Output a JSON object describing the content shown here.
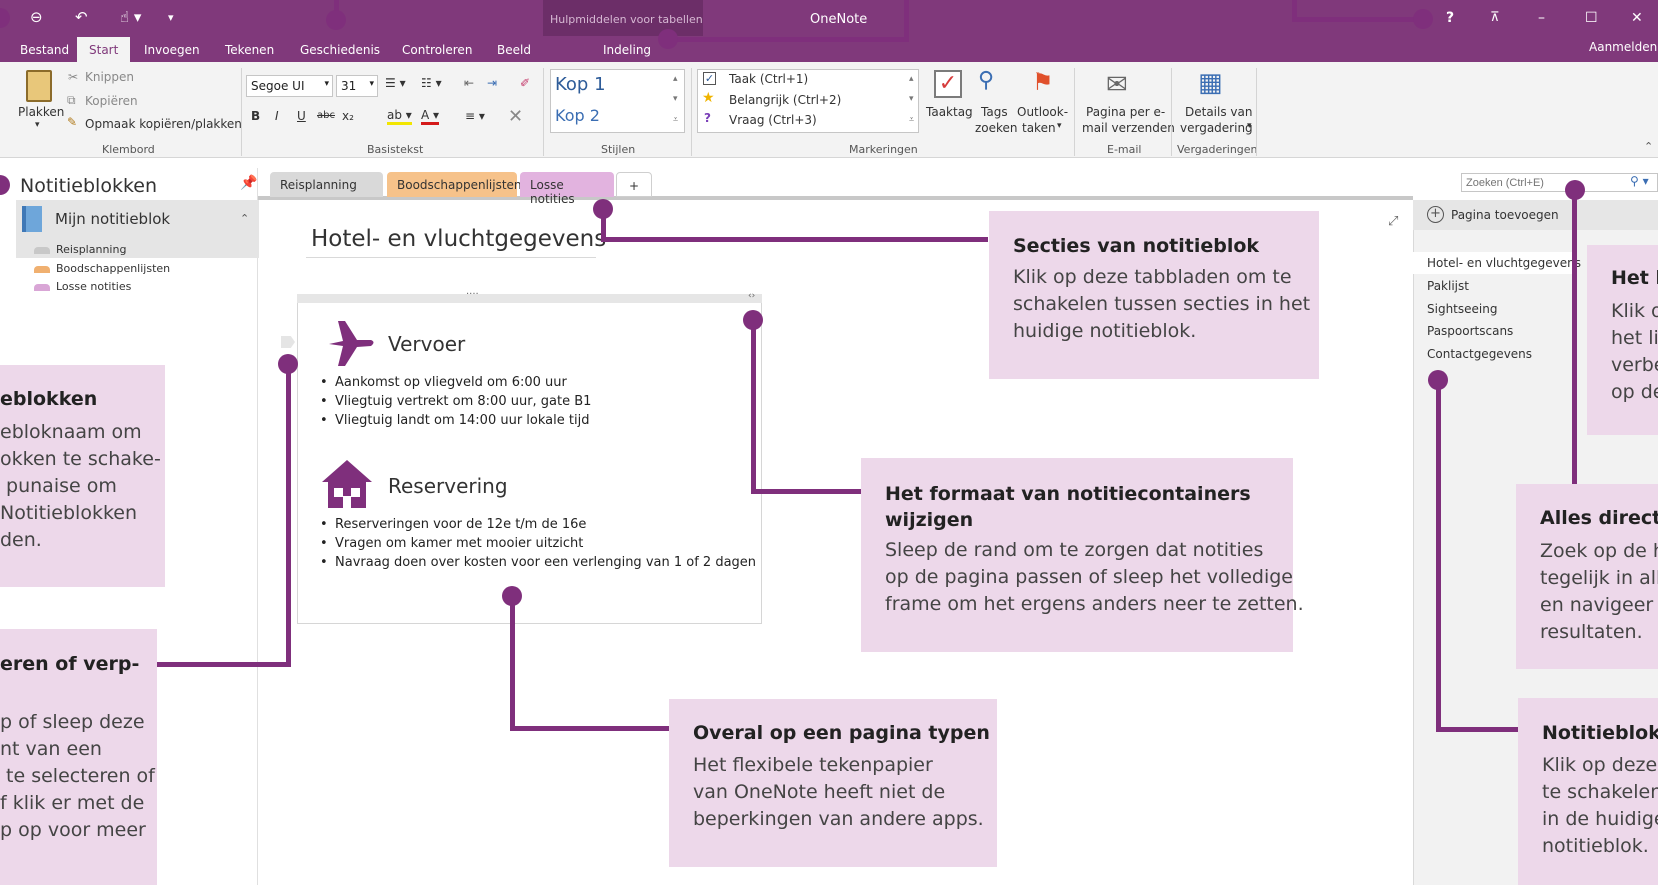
{
  "titlebar": {
    "app_title": "OneNote",
    "context_label": "Hulpmiddelen voor tabellen",
    "signin": "Aanmelden",
    "help": "?",
    "icons": [
      "back-icon",
      "undo-icon",
      "touch-mode-icon",
      "customize-qat-icon",
      "ribbon-display-icon",
      "minimize-icon",
      "maximize-icon",
      "close-icon"
    ]
  },
  "ribbon_tabs": [
    "Bestand",
    "Start",
    "Invoegen",
    "Tekenen",
    "Geschiedenis",
    "Controleren",
    "Beeld",
    "Indeling"
  ],
  "ribbon": {
    "clipboard": {
      "paste": "Plakken",
      "cut": "Knippen",
      "copy": "Kopiëren",
      "format_painter": "Opmaak kopiëren/plakken",
      "label": "Klembord"
    },
    "basic_text": {
      "font": "Segoe UI",
      "size": "31",
      "label": "Basistekst",
      "buttons": [
        "B",
        "I",
        "U",
        "abc",
        "x₂"
      ]
    },
    "styles": {
      "items": [
        "Kop 1",
        "Kop 2"
      ],
      "label": "Stijlen"
    },
    "tags": {
      "items": [
        "Taak (Ctrl+1)",
        "Belangrijk (Ctrl+2)",
        "Vraag (Ctrl+3)"
      ],
      "todo": "Taaktag",
      "find": [
        "Tags",
        "zoeken"
      ],
      "outlook": [
        "Outlook-",
        "taken"
      ],
      "label": "Markeringen"
    },
    "email": {
      "button": [
        "Pagina per e-",
        "mail verzenden"
      ],
      "label": "E-mail"
    },
    "meetings": {
      "button": [
        "Details van",
        "vergadering"
      ],
      "label": "Vergaderingen"
    }
  },
  "notebooks": {
    "header": "Notitieblokken",
    "notebook_name": "Mijn notitieblok",
    "sections": [
      {
        "name": "Reisplanning",
        "color": "#c8c8c8"
      },
      {
        "name": "Boodschappenlijsten",
        "color": "#f0b070"
      },
      {
        "name": "Losse notities",
        "color": "#d9a6d6"
      }
    ]
  },
  "section_tabs": [
    {
      "label": "Reisplanning",
      "color": "#d9d9d9"
    },
    {
      "label": "Boodschappenlijsten",
      "color": "#f6c28a"
    },
    {
      "label": "Losse notities",
      "color": "#e2b3df"
    },
    {
      "label": "+",
      "color": "#ffffff"
    }
  ],
  "search": {
    "placeholder": "Zoeken (Ctrl+E)"
  },
  "page": {
    "title": "Hotel- en vluchtgegevens",
    "blocks": [
      {
        "heading": "Vervoer",
        "icon": "airplane-icon",
        "bullets": [
          "Aankomst op vliegveld om 6:00 uur",
          "Vliegtuig vertrekt om 8:00 uur, gate B1",
          "Vliegtuig landt om 14:00 uur lokale tijd"
        ]
      },
      {
        "heading": "Reservering",
        "icon": "house-icon",
        "bullets": [
          "Reserveringen voor de 12e t/m de 16e",
          "Vragen om kamer met mooier uitzicht",
          "Navraag doen over kosten voor een verlenging van 1 of 2 dagen"
        ]
      }
    ]
  },
  "pages_pane": {
    "add_page": "Pagina toevoegen",
    "pages": [
      "Hotel- en vluchtgegevens",
      "Paklijst",
      "Sightseeing",
      "Paspoortscans",
      "Contactgegevens"
    ]
  },
  "callouts": {
    "sections": {
      "title": "Secties van notitieblok",
      "body": "Klik op deze tabbladen om te\nschakelen tussen secties in het\nhuidige notitieblok."
    },
    "resize": {
      "title": "Het formaat van notitiecontainers\nwijzigen",
      "body": "Sleep de rand om te zorgen dat notities\nop de pagina passen of sleep het volledige\nframe om het ergens anders neer te zetten."
    },
    "type_anywhere": {
      "title": "Overal op een pagina typen",
      "body": "Het flexibele tekenpapier\nvan OneNote heeft niet de\nbeperkingen van andere apps."
    },
    "notebooks": {
      "title": "eblokken",
      "body": "ebloknaam om\nokken te schake-\n punaise om\nNotitieblokken\nden."
    },
    "select_move": {
      "title": "eren of verp-",
      "body": "p of sleep deze\nnt van een\n te selecteren of\nf klik er met de\np op voor meer"
    },
    "link": {
      "title": "Het l",
      "body": "Klik o\nhet lin\nverbe\nop de"
    },
    "search_all": {
      "title": "Alles direct v",
      "body": "Zoek op de h\ntegelijk in all\nen navigeer n\nresultaten."
    },
    "pages": {
      "title": "Notitieblokp",
      "body": "Klik op deze\nte schakelen\nin de huidige\nnotitieblok."
    }
  }
}
